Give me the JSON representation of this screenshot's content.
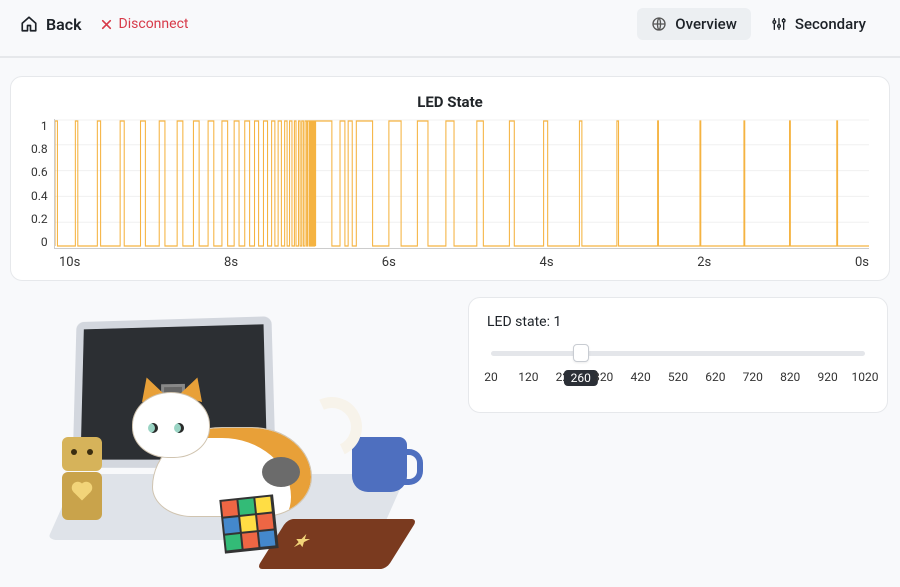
{
  "topbar": {
    "back_label": "Back",
    "disconnect_label": "Disconnect",
    "tabs": [
      {
        "label": "Overview",
        "active": true
      },
      {
        "label": "Secondary",
        "active": false
      }
    ]
  },
  "chart_data": {
    "type": "line",
    "title": "LED State",
    "xlabel": "",
    "ylabel": "",
    "ylim": [
      0,
      1
    ],
    "y_ticks": [
      1.0,
      0.8,
      0.6,
      0.4,
      0.2,
      0.0
    ],
    "x_ticks": [
      "10s",
      "8s",
      "6s",
      "4s",
      "2s",
      "0s"
    ],
    "x_range_seconds": [
      10,
      0
    ],
    "signal": "square",
    "signal_description": "Digital 0/1 square wave over a 10-second window. Dense high-frequency toggling between ~10s and ~6.3s (interval shrinking), then ~16 progressively widening pulses from ~6.3s to 0s.",
    "edges_seconds_ago": [
      10.0,
      9.97,
      9.75,
      9.72,
      9.48,
      9.44,
      9.2,
      9.15,
      8.95,
      8.89,
      8.72,
      8.65,
      8.5,
      8.43,
      8.3,
      8.23,
      8.12,
      8.05,
      7.95,
      7.88,
      7.8,
      7.74,
      7.67,
      7.61,
      7.55,
      7.5,
      7.44,
      7.39,
      7.34,
      7.3,
      7.26,
      7.22,
      7.18,
      7.15,
      7.12,
      7.09,
      7.06,
      7.04,
      7.01,
      6.99,
      6.97,
      6.95,
      6.93,
      6.91,
      6.9,
      6.88,
      6.87,
      6.86,
      6.85,
      6.84,
      6.83,
      6.82,
      6.81,
      6.8,
      6.8,
      6.6,
      6.5,
      6.44,
      6.4,
      6.35,
      6.3,
      6.1,
      5.9,
      5.75,
      5.55,
      5.42,
      5.2,
      5.1,
      4.82,
      4.74,
      4.42,
      4.36,
      4.0,
      3.95,
      3.56,
      3.53,
      3.1,
      3.08,
      2.6,
      2.59,
      2.08,
      2.07,
      1.54,
      1.53,
      0.98,
      0.97,
      0.4,
      0.39
    ]
  },
  "led_panel": {
    "label_prefix": "LED state: ",
    "value": 1,
    "slider": {
      "min": 20,
      "max": 1020,
      "step": 100,
      "current": 260,
      "marks": [
        20,
        120,
        220,
        260,
        320,
        420,
        520,
        620,
        720,
        820,
        920,
        1020
      ]
    }
  },
  "icons": {
    "home": "home-icon",
    "close": "close-icon",
    "globe": "globe-icon",
    "sliders": "sliders-icon"
  }
}
